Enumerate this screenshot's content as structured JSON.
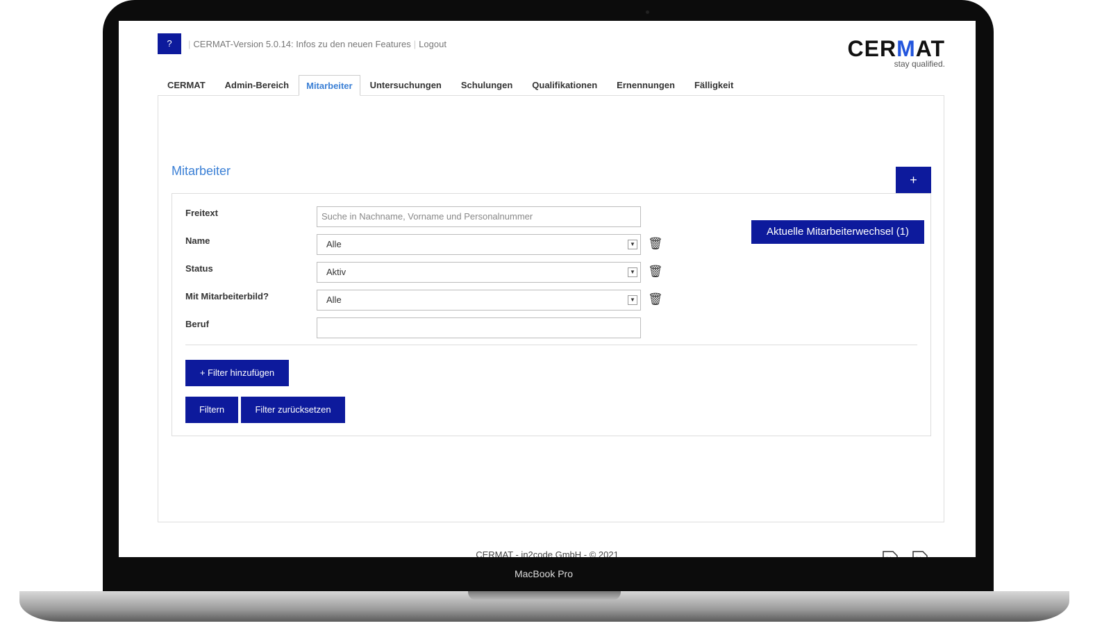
{
  "device": {
    "label": "MacBook Pro"
  },
  "header": {
    "help": "?",
    "version_link": "CERMAT-Version 5.0.14: Infos zu den neuen Features",
    "logout": "Logout",
    "logo_text": "CERMAT",
    "logo_tagline": "stay qualified.",
    "accent": "#0d1a9c"
  },
  "tabs": [
    {
      "label": "CERMAT"
    },
    {
      "label": "Admin-Bereich"
    },
    {
      "label": "Mitarbeiter",
      "active": true
    },
    {
      "label": "Untersuchungen"
    },
    {
      "label": "Schulungen"
    },
    {
      "label": "Qualifikationen"
    },
    {
      "label": "Ernennungen"
    },
    {
      "label": "Fälligkeit"
    }
  ],
  "main": {
    "title": "Mitarbeiter",
    "add": "+",
    "changes_button": "Aktuelle Mitarbeiterwechsel (1)",
    "filters": [
      {
        "label": "Freitext",
        "value": "",
        "placeholder": "Suche in Nachname, Vorname und Personalnummer"
      },
      {
        "label": "Name",
        "value": "Alle"
      },
      {
        "label": "Status",
        "value": "Aktiv"
      },
      {
        "label": "Mit Mitarbeiterbild?",
        "value": "Alle"
      },
      {
        "label": "Beruf",
        "value": ""
      }
    ],
    "add_filter": "+ Filter hinzufügen",
    "filter": "Filtern",
    "reset": "Filter zurücksetzen",
    "icons": [
      "excel-export-icon",
      "excel-import-icon"
    ]
  },
  "footer": "CERMAT - in2code GmbH - © 2021"
}
